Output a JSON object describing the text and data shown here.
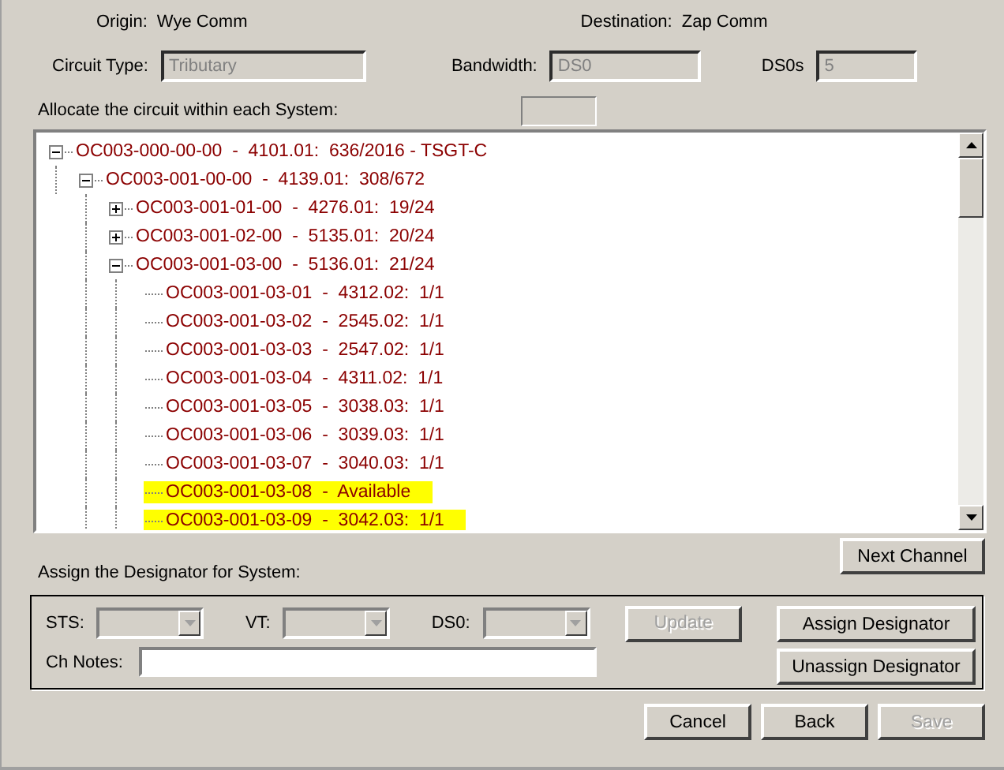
{
  "origin": {
    "label": "Origin:",
    "value": "Wye Comm"
  },
  "destination": {
    "label": "Destination:",
    "value": "Zap Comm"
  },
  "fields": [
    {
      "label": "Circuit Type:",
      "value": "Tributary",
      "disabled": true
    },
    {
      "label": "Bandwidth:",
      "value": "DS0",
      "disabled": true
    },
    {
      "label": "DS0s",
      "value": "5",
      "disabled": true
    }
  ],
  "allocate": {
    "label": "Allocate the circuit within each System:"
  },
  "tree": [
    {
      "label": "OC003-000-00-00  -  4101.01:  636/2016 - TSGT-C",
      "expanded": true,
      "highlighted": false,
      "children": [
        {
          "label": "OC003-001-00-00  -  4139.01:  308/672",
          "expanded": true,
          "highlighted": false,
          "children": [
            {
              "label": "OC003-001-01-00  -  4276.01:  19/24",
              "expanded": false,
              "highlighted": false
            },
            {
              "label": "OC003-001-02-00  -  5135.01:  20/24",
              "expanded": false,
              "highlighted": false
            },
            {
              "label": "OC003-001-03-00  -  5136.01:  21/24",
              "expanded": true,
              "highlighted": false,
              "children": [
                {
                  "label": "OC003-001-03-01  -  4312.02:  1/1",
                  "highlighted": false
                },
                {
                  "label": "OC003-001-03-02  -  2545.02:  1/1",
                  "highlighted": false
                },
                {
                  "label": "OC003-001-03-03  -  2547.02:  1/1",
                  "highlighted": false
                },
                {
                  "label": "OC003-001-03-04  -  4311.02:  1/1",
                  "highlighted": false
                },
                {
                  "label": "OC003-001-03-05  -  3038.03:  1/1",
                  "highlighted": false
                },
                {
                  "label": "OC003-001-03-06  -  3039.03:  1/1",
                  "highlighted": false
                },
                {
                  "label": "OC003-001-03-07  -  3040.03:  1/1",
                  "highlighted": false
                },
                {
                  "label": "OC003-001-03-08  -  Available",
                  "highlighted": true
                },
                {
                  "label": "OC003-001-03-09  -  3042.03:  1/1",
                  "highlighted": true
                }
              ]
            }
          ]
        }
      ]
    }
  ],
  "next_channel_button": {
    "label": "Next Channel",
    "disabled": false
  },
  "assign": {
    "label": "Assign the Designator for System:"
  },
  "selectors": [
    {
      "label": "STS:",
      "disabled": true
    },
    {
      "label": "VT:",
      "disabled": true
    },
    {
      "label": "DS0:",
      "disabled": true
    }
  ],
  "update_button": {
    "label": "Update",
    "disabled": true
  },
  "assign_button": {
    "label": "Assign Designator",
    "disabled": false
  },
  "unassign_button": {
    "label": "Unassign Designator",
    "disabled": false
  },
  "notes": {
    "label": "Ch Notes:"
  },
  "footer_buttons": [
    {
      "label": "Cancel",
      "disabled": false
    },
    {
      "label": "Back",
      "disabled": false
    },
    {
      "label": "Save",
      "disabled": true
    }
  ]
}
